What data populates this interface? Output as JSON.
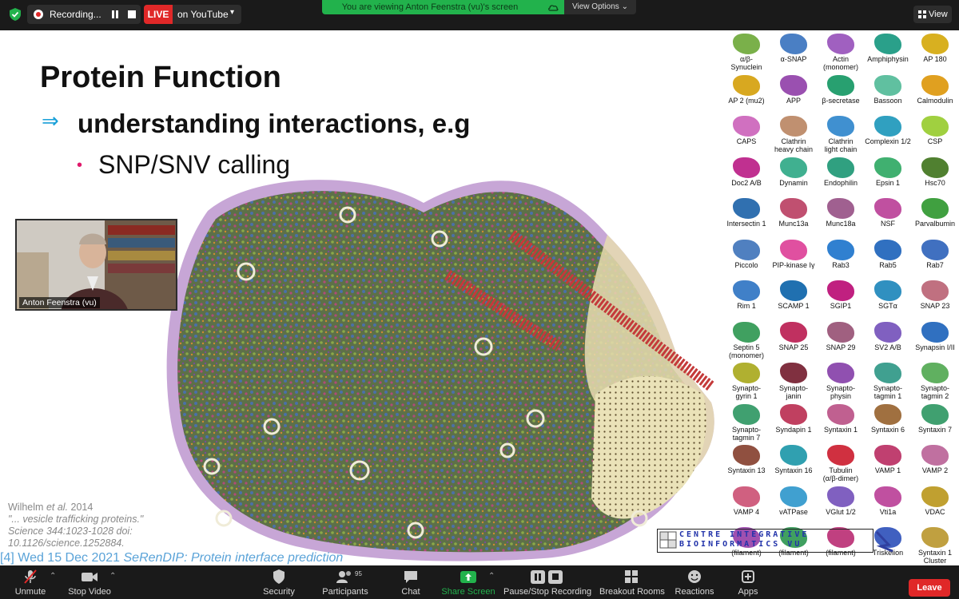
{
  "topbar": {
    "recording_label": "Recording...",
    "live_badge": "LIVE",
    "live_target": "on YouTube",
    "viewing_banner": "You are viewing Anton Feenstra (vu)'s screen",
    "view_options": "View Options",
    "view_button": "View"
  },
  "slide": {
    "title": "Protein Function",
    "bullet_1": "understanding interactions, e.g",
    "bullet_2": "SNP/SNV calling",
    "citation": {
      "authors": "Wilhelm",
      "etal": "et al.",
      "year": "2014",
      "quote": "\"... vesicle trafficking proteins.\"",
      "journal": "Science 344:1023-1028 doi:",
      "doi": "10.1126/science.1252884."
    },
    "footer": {
      "number": "[4]",
      "date": "Wed 15 Dec 2021",
      "series": "SeRenDIP:",
      "topic": "Protein interface prediction"
    },
    "logo": {
      "row1": "CENTRE INTEGRATIVE",
      "row2": "BIOINFORMATICS VU"
    },
    "proteins": [
      {
        "name": "α/β-\nSynuclein",
        "color": "#7ab04a"
      },
      {
        "name": "α-SNAP",
        "color": "#4a7fc4"
      },
      {
        "name": "Actin\n(monomer)",
        "color": "#a060c0"
      },
      {
        "name": "Amphiphysin",
        "color": "#2aa08a"
      },
      {
        "name": "AP 180",
        "color": "#d8b020"
      },
      {
        "name": "AP 2 (mu2)",
        "color": "#d8a820"
      },
      {
        "name": "APP",
        "color": "#9a50b0"
      },
      {
        "name": "β-secretase",
        "color": "#28a070"
      },
      {
        "name": "Bassoon",
        "color": "#60c0a0"
      },
      {
        "name": "Calmodulin",
        "color": "#e0a020"
      },
      {
        "name": "CAPS",
        "color": "#d070c0"
      },
      {
        "name": "Clathrin\nheavy chain",
        "color": "#c09070"
      },
      {
        "name": "Clathrin\nlight chain",
        "color": "#4090d0"
      },
      {
        "name": "Complexin 1/2",
        "color": "#30a0c0"
      },
      {
        "name": "CSP",
        "color": "#a0d040"
      },
      {
        "name": "Doc2 A/B",
        "color": "#c03090"
      },
      {
        "name": "Dynamin",
        "color": "#40b090"
      },
      {
        "name": "Endophilin",
        "color": "#30a080"
      },
      {
        "name": "Epsin 1",
        "color": "#40b070"
      },
      {
        "name": "Hsc70",
        "color": "#508030"
      },
      {
        "name": "Intersectin 1",
        "color": "#3070b0"
      },
      {
        "name": "Munc13a",
        "color": "#c05070"
      },
      {
        "name": "Munc18a",
        "color": "#a06090"
      },
      {
        "name": "NSF",
        "color": "#c050a0"
      },
      {
        "name": "Parvalbumin",
        "color": "#40a040"
      },
      {
        "name": "Piccolo",
        "color": "#5080c0"
      },
      {
        "name": "PIP-kinase Iγ",
        "color": "#e050a0"
      },
      {
        "name": "Rab3",
        "color": "#3080d0"
      },
      {
        "name": "Rab5",
        "color": "#3070c0"
      },
      {
        "name": "Rab7",
        "color": "#4070c0"
      },
      {
        "name": "Rim 1",
        "color": "#4080c8"
      },
      {
        "name": "SCAMP 1",
        "color": "#2070b0"
      },
      {
        "name": "SGIP1",
        "color": "#c02080"
      },
      {
        "name": "SGTα",
        "color": "#3090c0"
      },
      {
        "name": "SNAP 23",
        "color": "#c07080"
      },
      {
        "name": "Septin 5\n(monomer)",
        "color": "#40a060"
      },
      {
        "name": "SNAP 25",
        "color": "#c03060"
      },
      {
        "name": "SNAP 29",
        "color": "#a06080"
      },
      {
        "name": "SV2 A/B",
        "color": "#8060c0"
      },
      {
        "name": "Synapsin I/II",
        "color": "#3070c0"
      },
      {
        "name": "Synapto-\ngyrin 1",
        "color": "#b0b030"
      },
      {
        "name": "Synapto-\njanin",
        "color": "#803040"
      },
      {
        "name": "Synapto-\nphysin",
        "color": "#9050b0"
      },
      {
        "name": "Synapto-\ntagmin 1",
        "color": "#40a090"
      },
      {
        "name": "Synapto-\ntagmin 2",
        "color": "#60b060"
      },
      {
        "name": "Synapto-\ntagmin 7",
        "color": "#40a070"
      },
      {
        "name": "Syndapin 1",
        "color": "#c04060"
      },
      {
        "name": "Syntaxin 1",
        "color": "#c06090"
      },
      {
        "name": "Syntaxin 6",
        "color": "#a07040"
      },
      {
        "name": "Syntaxin 7",
        "color": "#40a070"
      },
      {
        "name": "Syntaxin 13",
        "color": "#905040"
      },
      {
        "name": "Syntaxin 16",
        "color": "#30a0b0"
      },
      {
        "name": "Tubulin\n(α/β-dimer)",
        "color": "#d03040"
      },
      {
        "name": "VAMP 1",
        "color": "#c04070"
      },
      {
        "name": "VAMP 2",
        "color": "#c070a0"
      },
      {
        "name": "VAMP 4",
        "color": "#d06080"
      },
      {
        "name": "vATPase",
        "color": "#40a0d0"
      },
      {
        "name": "VGlut 1/2",
        "color": "#8060c0"
      },
      {
        "name": "Vti1a",
        "color": "#c050a0"
      },
      {
        "name": "VDAC",
        "color": "#c0a030"
      },
      {
        "name": "(filament)",
        "color": "#a050b0"
      },
      {
        "name": "(filament)",
        "color": "#40a060"
      },
      {
        "name": "(filament)",
        "color": "#c04080"
      },
      {
        "name": "Triskelion",
        "color": "#4060c0"
      },
      {
        "name": "Syntaxin 1\nCluster",
        "color": "#c0a040"
      }
    ]
  },
  "webcam": {
    "name": "Anton Feenstra (vu)"
  },
  "toolbar": {
    "unmute": "Unmute",
    "stop_video": "Stop Video",
    "security": "Security",
    "participants": "Participants",
    "participants_count": "95",
    "chat": "Chat",
    "share_screen": "Share Screen",
    "pause_stop_recording": "Pause/Stop Recording",
    "breakout_rooms": "Breakout Rooms",
    "reactions": "Reactions",
    "apps": "Apps",
    "leave": "Leave"
  }
}
